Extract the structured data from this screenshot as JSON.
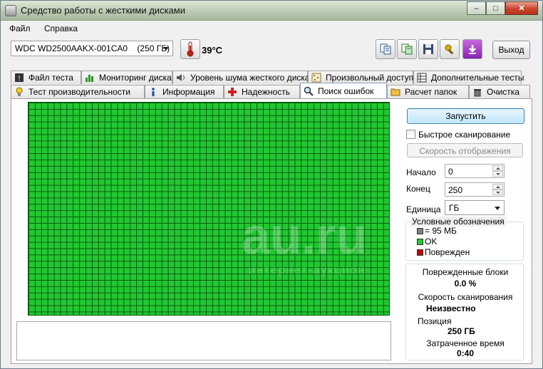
{
  "window": {
    "title": "Средство работы с жесткими дисками",
    "minimize": "–",
    "maximize": "□",
    "close": "✕"
  },
  "menu": {
    "file": "Файл",
    "help": "Справка"
  },
  "toolbar": {
    "drive": "WDC WD2500AAKX-001CA0    (250 ГБ)",
    "temperature": "39°C",
    "exit": "Выход",
    "icons": [
      "copy-icon",
      "copy-green-icon",
      "save-icon",
      "tools-icon",
      "download-icon"
    ]
  },
  "tabs_row1": [
    {
      "label": "Файл теста",
      "icon": "info-file-icon"
    },
    {
      "label": "Мониторинг диска",
      "icon": "chart-icon"
    },
    {
      "label": "Уровень шума жесткого диска",
      "icon": "speaker-icon"
    },
    {
      "label": "Произвольный доступ",
      "icon": "random-icon"
    },
    {
      "label": "Дополнительные тесты",
      "icon": "grid-icon"
    }
  ],
  "tabs_row2": [
    {
      "label": "Тест производительности",
      "icon": "bulb-icon"
    },
    {
      "label": "Информация",
      "icon": "info-icon"
    },
    {
      "label": "Надежность",
      "icon": "cross-icon"
    },
    {
      "label": "Поиск ошибок",
      "icon": "magnifier-icon",
      "active": true
    },
    {
      "label": "Расчет папок",
      "icon": "folder-icon"
    },
    {
      "label": "Очистка",
      "icon": "trash-icon"
    }
  ],
  "scan": {
    "start_button": "Запустить",
    "quick_scan": "Быстрое сканирование",
    "quick_scan_checked": false,
    "display_speed_button": "Скорость отображения",
    "start_label": "Начало",
    "start_value": "0",
    "end_label": "Конец",
    "end_value": "250",
    "unit_label": "Единица",
    "unit_value": "ГБ"
  },
  "legend": {
    "title": "Условные обозначения",
    "items": [
      {
        "label": "= 95 МБ",
        "color": "#808080"
      },
      {
        "label": "OK",
        "color": "#22c832"
      },
      {
        "label": "Поврежден",
        "color": "#c00000"
      }
    ]
  },
  "stats": {
    "damaged_label": "Поврежденные блоки",
    "damaged_value": "0.0 %",
    "speed_label": "Скорость сканирования",
    "speed_value": "Неизвестно",
    "position_label": "Позиция",
    "position_value": "250 ГБ",
    "elapsed_label": "Затраченное время",
    "elapsed_value": "0:40"
  },
  "colors": {
    "ok_block": "#22c832",
    "grid_line": "#0a5a10",
    "accent": "#3c7fb1"
  }
}
